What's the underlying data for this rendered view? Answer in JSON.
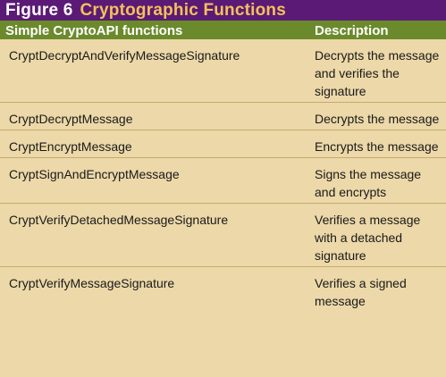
{
  "figure": {
    "label": "Figure 6",
    "title": "Cryptographic Functions"
  },
  "table": {
    "headers": {
      "function": "Simple CryptoAPI functions",
      "description": "Description"
    },
    "rows": [
      {
        "function": "CryptDecryptAndVerifyMessageSignature",
        "description": "Decrypts the message and verifies the signature"
      },
      {
        "function": "CryptDecryptMessage",
        "description": "Decrypts the message"
      },
      {
        "function": "CryptEncryptMessage",
        "description": "Encrypts the message"
      },
      {
        "function": "CryptSignAndEncryptMessage",
        "description": "Signs the message and encrypts"
      },
      {
        "function": "CryptVerifyDetachedMessageSignature",
        "description": "Verifies a message with a detached signature"
      },
      {
        "function": "CryptVerifyMessageSignature",
        "description": "Verifies a signed message"
      }
    ]
  },
  "colors": {
    "title_bar": "#5b1a76",
    "title_text": "#f3c15a",
    "header_bar": "#6b8a2c",
    "background": "#ecd8a8"
  }
}
